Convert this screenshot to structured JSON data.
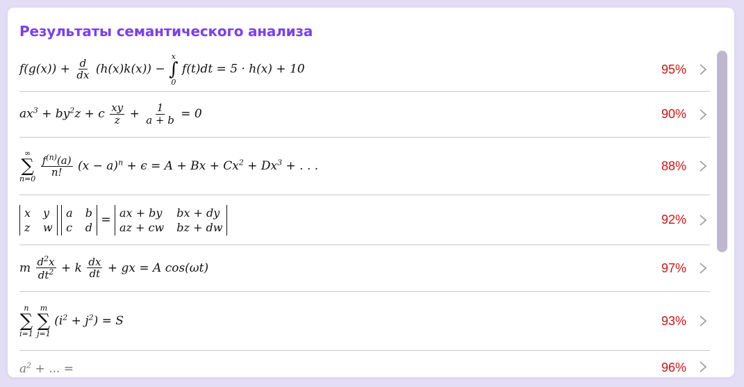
{
  "panel": {
    "title": "Результаты семантического анализа"
  },
  "results": [
    {
      "score": "95%"
    },
    {
      "score": "90%"
    },
    {
      "score": "88%"
    },
    {
      "score": "92%"
    },
    {
      "score": "97%"
    },
    {
      "score": "93%"
    },
    {
      "score": "96%"
    }
  ],
  "icons": {
    "row_action": "chevron-right-icon"
  },
  "colors": {
    "title": "#7a3ff0",
    "score": "#d51111",
    "background": "#e3def6",
    "scrollbar": "#bdb8cf"
  }
}
